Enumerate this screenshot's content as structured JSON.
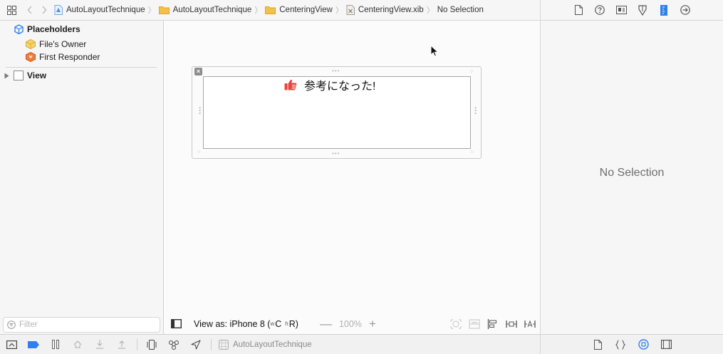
{
  "jumpbar": {
    "crumbs": [
      {
        "label": "AutoLayoutTechnique",
        "icon": "project-icon"
      },
      {
        "label": "AutoLayoutTechnique",
        "icon": "folder-icon"
      },
      {
        "label": "CenteringView",
        "icon": "folder-icon"
      },
      {
        "label": "CenteringView.xib",
        "icon": "xib-file-icon"
      },
      {
        "label": "No Selection",
        "icon": ""
      }
    ]
  },
  "outline": {
    "placeholders_label": "Placeholders",
    "files_owner_label": "File's Owner",
    "first_responder_label": "First Responder",
    "view_label": "View",
    "filter_placeholder": "Filter"
  },
  "canvas": {
    "label_text": "参考になった!",
    "view_as_label": "View as: iPhone 8 (",
    "size_class_w": "w",
    "size_class_w_value": "C",
    "size_class_h": "h",
    "size_class_h_value": "R)",
    "zoom_level": "100%"
  },
  "inspector": {
    "no_selection": "No Selection"
  },
  "debugbar": {
    "target_label": "AutoLayoutTechnique"
  },
  "colors": {
    "folder": "#f5c04a",
    "project": "#4a90e2",
    "accent_blue": "#2f80ed",
    "responder_orange": "#ef7d3c",
    "owner_yellow": "#f6d36b",
    "thumb_red": "#e8463c"
  }
}
